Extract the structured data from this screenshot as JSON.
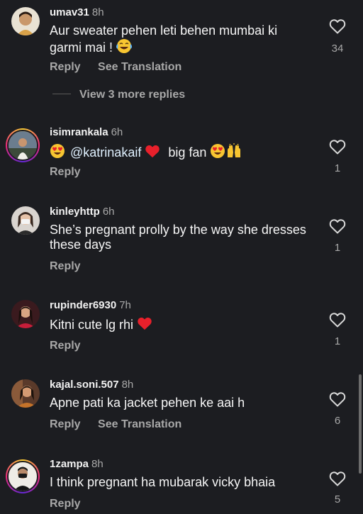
{
  "comments": [
    {
      "username": "umav31",
      "time": "8h",
      "text": "Aur sweater pehen leti behen mumbai ki garmi mai !",
      "reply_label": "Reply",
      "translate_label": "See Translation",
      "likes": "34",
      "view_replies": "View 3 more replies",
      "has_story_ring": false
    },
    {
      "username": "isimrankala",
      "time": "6h",
      "mention": "@katrinakaif",
      "text_after": "big fan",
      "reply_label": "Reply",
      "likes": "1",
      "has_story_ring": true
    },
    {
      "username": "kinleyhttp",
      "time": "6h",
      "text": "She’s pregnant prolly by the way she dresses these days",
      "reply_label": "Reply",
      "likes": "1",
      "has_story_ring": false
    },
    {
      "username": "rupinder6930",
      "time": "7h",
      "text": "Kitni cute lg rhi",
      "reply_label": "Reply",
      "likes": "1",
      "has_story_ring": false
    },
    {
      "username": "kajal.soni.507",
      "time": "8h",
      "text": "Apne pati ka jacket pehen ke aai h",
      "reply_label": "Reply",
      "translate_label": "See Translation",
      "likes": "6",
      "has_story_ring": false
    },
    {
      "username": "1zampa",
      "time": "8h",
      "text": "I think pregnant ha mubarak vicky bhaia",
      "reply_label": "Reply",
      "likes": "5",
      "has_story_ring": true
    }
  ],
  "icons": {
    "like": "heart-outline-icon",
    "red_heart": "red-heart-emoji",
    "laughing": "laughing-crying-emoji",
    "heart_eyes": "heart-eyes-emoji",
    "raised_hands": "raised-hands-emoji"
  },
  "colors": {
    "background": "#1c1d21",
    "primary_text": "#f5f5f5",
    "secondary_text": "#a8a8a8",
    "mention": "#e0f1ff",
    "red_heart": "#e8202b"
  }
}
